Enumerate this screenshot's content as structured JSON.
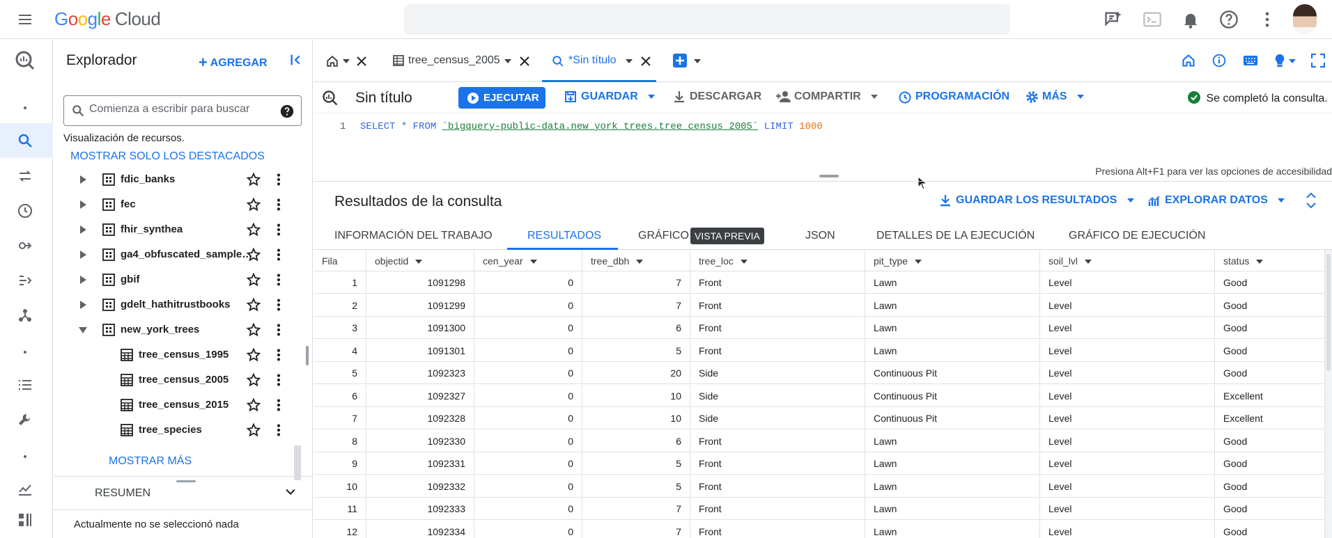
{
  "app": {
    "logo_google": "Google",
    "logo_cloud": "Cloud"
  },
  "explorer": {
    "title": "Explorador",
    "add_label": "AGREGAR",
    "search_placeholder": "Comienza a escribir para buscar",
    "resource_view": "Visualización de recursos.",
    "show_starred": "MOSTRAR SOLO LOS DESTACADOS",
    "datasets": [
      {
        "label": "fdic_banks"
      },
      {
        "label": "fec"
      },
      {
        "label": "fhir_synthea"
      },
      {
        "label": "ga4_obfuscated_sample…"
      },
      {
        "label": "gbif"
      },
      {
        "label": "gdelt_hathitrustbooks"
      },
      {
        "label": "new_york_trees"
      }
    ],
    "tables": [
      {
        "label": "tree_census_1995"
      },
      {
        "label": "tree_census_2005"
      },
      {
        "label": "tree_census_2015"
      },
      {
        "label": "tree_species"
      }
    ],
    "show_more": "MOSTRAR MÁS",
    "summary_label": "RESUMEN",
    "nothing_selected": "Actualmente no se seleccionó nada"
  },
  "tabs": [
    {
      "label": "tree_census_2005"
    },
    {
      "label": "*Sin título"
    }
  ],
  "toolbar": {
    "query_title": "Sin título",
    "run": "EJECUTAR",
    "save": "GUARDAR",
    "download": "DESCARGAR",
    "share": "COMPARTIR",
    "schedule": "PROGRAMACIÓN",
    "more": "MÁS",
    "status": "Se completó la consulta."
  },
  "editor": {
    "line_number": "1",
    "q_select": "SELECT",
    "q_star": " * ",
    "q_from": "FROM",
    "q_table": "`bigquery-public-data.new_york_trees.tree_census_2005`",
    "q_limit": "LIMIT",
    "q_num": "1000",
    "accessibility_hint": "Presiona Alt+F1 para ver las opciones de accesibilidad"
  },
  "results": {
    "title": "Resultados de la consulta",
    "save_results": "GUARDAR LOS RESULTADOS",
    "explore_data": "EXPLORAR DATOS",
    "tabs": {
      "job_info": "INFORMACIÓN DEL TRABAJO",
      "results": "RESULTADOS",
      "chart": "GRÁFICO",
      "preview_badge": "VISTA PREVIA",
      "json": "JSON",
      "exec_details": "DETALLES DE LA EJECUCIÓN",
      "exec_graph": "GRÁFICO DE EJECUCIÓN"
    },
    "columns": [
      "Fila",
      "objectid",
      "cen_year",
      "tree_dbh",
      "tree_loc",
      "pit_type",
      "soil_lvl",
      "status"
    ],
    "rows": [
      [
        "1",
        "1091298",
        "0",
        "7",
        "Front",
        "Lawn",
        "Level",
        "Good"
      ],
      [
        "2",
        "1091299",
        "0",
        "7",
        "Front",
        "Lawn",
        "Level",
        "Good"
      ],
      [
        "3",
        "1091300",
        "0",
        "6",
        "Front",
        "Lawn",
        "Level",
        "Good"
      ],
      [
        "4",
        "1091301",
        "0",
        "5",
        "Front",
        "Lawn",
        "Level",
        "Good"
      ],
      [
        "5",
        "1092323",
        "0",
        "20",
        "Side",
        "Continuous Pit",
        "Level",
        "Good"
      ],
      [
        "6",
        "1092327",
        "0",
        "10",
        "Side",
        "Continuous Pit",
        "Level",
        "Excellent"
      ],
      [
        "7",
        "1092328",
        "0",
        "10",
        "Side",
        "Continuous Pit",
        "Level",
        "Excellent"
      ],
      [
        "8",
        "1092330",
        "0",
        "6",
        "Front",
        "Lawn",
        "Level",
        "Good"
      ],
      [
        "9",
        "1092331",
        "0",
        "5",
        "Front",
        "Lawn",
        "Level",
        "Good"
      ],
      [
        "10",
        "1092332",
        "0",
        "5",
        "Front",
        "Lawn",
        "Level",
        "Good"
      ],
      [
        "11",
        "1092333",
        "0",
        "7",
        "Front",
        "Lawn",
        "Level",
        "Good"
      ],
      [
        "12",
        "1092334",
        "0",
        "7",
        "Front",
        "Lawn",
        "Level",
        "Good"
      ]
    ]
  },
  "colors": {
    "accent": "#1a73e8",
    "success": "#188038",
    "orange": "#e8710a"
  }
}
